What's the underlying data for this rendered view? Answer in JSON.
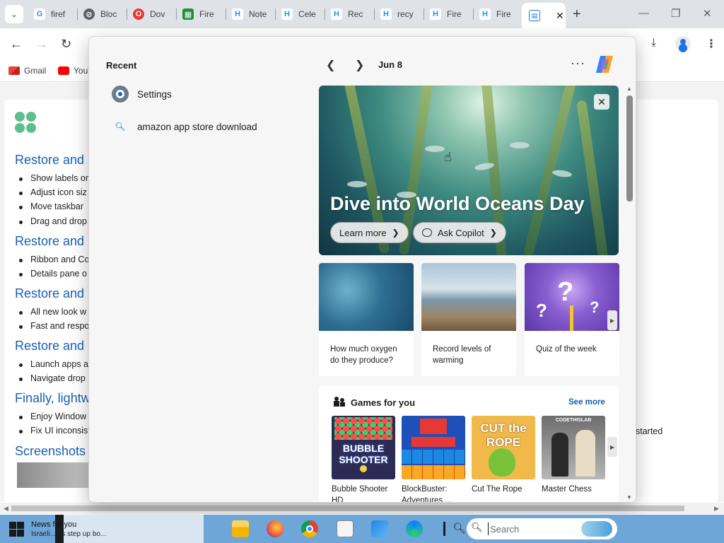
{
  "browser": {
    "tabs": [
      {
        "label": "firef",
        "icon": "google-g-icon",
        "color": "#4285f4"
      },
      {
        "label": "Bloc",
        "icon": "blocked-icon",
        "color": "#5f6368"
      },
      {
        "label": "Dov",
        "icon": "opera-icon",
        "color": "#e53935"
      },
      {
        "label": "Fire",
        "icon": "sheet-icon",
        "color": "#1e8e3e"
      },
      {
        "label": "Note",
        "icon": "hubspot-h-icon",
        "color": "#2196f3"
      },
      {
        "label": "Cele",
        "icon": "hubspot-h-icon",
        "color": "#2196f3"
      },
      {
        "label": "Rec",
        "icon": "hubspot-h-icon",
        "color": "#2196f3"
      },
      {
        "label": "recy",
        "icon": "hubspot-h-icon",
        "color": "#2196f3"
      },
      {
        "label": "Fire",
        "icon": "hubspot-h-icon",
        "color": "#2196f3"
      },
      {
        "label": "Fire",
        "icon": "hubspot-h-icon",
        "color": "#2196f3"
      }
    ],
    "active_tab_close": "✕",
    "new_tab": "+",
    "bookmarks": [
      {
        "label": "Gmail",
        "icon": "gmail-icon"
      },
      {
        "label": "YouT",
        "icon": "youtube-icon"
      }
    ]
  },
  "background_page": {
    "headings": [
      "Restore and im",
      "Restore and im",
      "Restore and im",
      "Restore and im",
      "Finally, lightw",
      "Screenshots"
    ],
    "bullets": [
      [
        "Show labels or",
        "Adjust icon siz",
        "Move taskbar",
        "Drag and drop"
      ],
      [
        "Ribbon and Co",
        "Details pane o"
      ],
      [
        "All new look w",
        "Fast and respo"
      ],
      [
        "Launch apps a",
        "Navigate drop"
      ],
      [
        "Enjoy Window",
        "Fix UI inconsist"
      ]
    ],
    "right_fragment": "started"
  },
  "panel": {
    "recent_title": "Recent",
    "recent_items": [
      {
        "label": "Settings",
        "icon": "settings-gear-icon"
      },
      {
        "label": "amazon app store download",
        "icon": "search-icon"
      }
    ],
    "date": "Jun 8",
    "more": "···",
    "hero": {
      "title": "Dive into World Oceans Day",
      "learn_more": "Learn more",
      "ask_copilot": "Ask Copilot",
      "close": "✕"
    },
    "tiles": [
      {
        "caption": "How much oxygen do they produce?",
        "image": "ocean-waves"
      },
      {
        "caption": "Record levels of warming",
        "image": "melting-ice"
      },
      {
        "caption": "Quiz of the week",
        "image": "question-marks"
      }
    ],
    "games": {
      "title": "Games for you",
      "see_more": "See more",
      "items": [
        {
          "name": "Bubble Shooter HD",
          "art": "BUBBLE SHOOTER"
        },
        {
          "name": "BlockBuster: Adventures ...",
          "art": ""
        },
        {
          "name": "Cut The Rope",
          "art": "CUT the ROPE"
        },
        {
          "name": "Master Chess",
          "art": "CODETHISLAB"
        }
      ]
    }
  },
  "taskbar": {
    "news_title": "News for you",
    "news_sub": "Israeli... es step up bo...",
    "search_placeholder": "Search"
  }
}
